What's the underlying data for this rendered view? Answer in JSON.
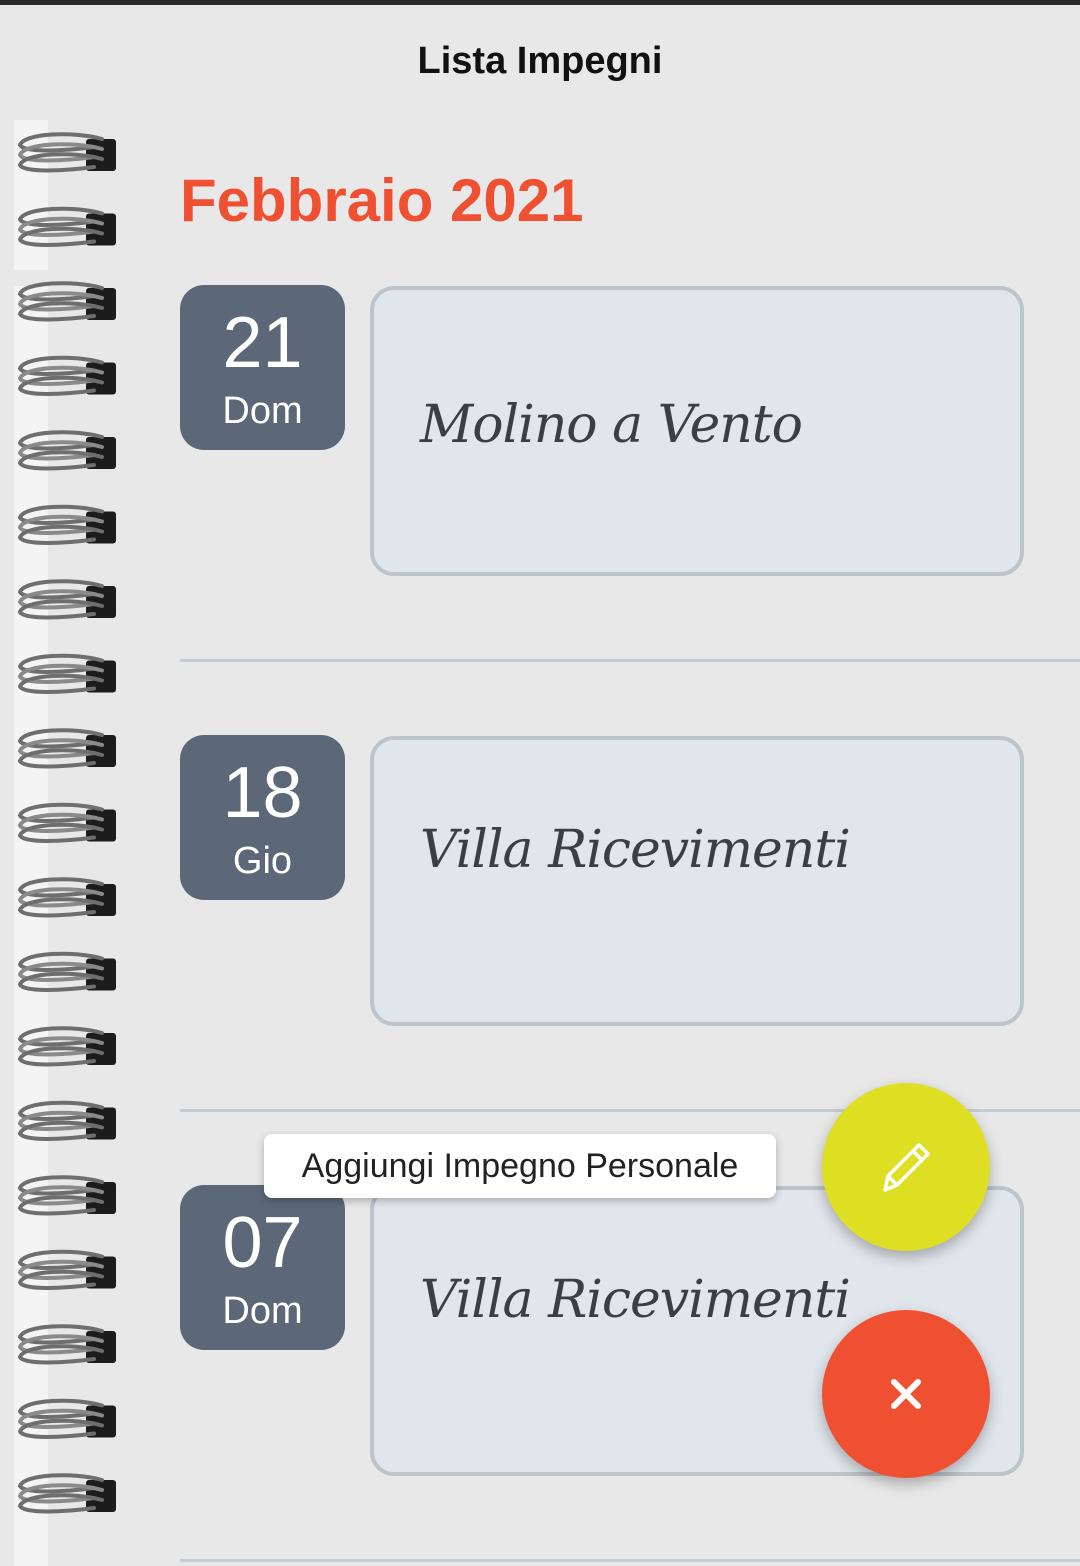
{
  "header": {
    "title": "Lista Impegni"
  },
  "month_heading": "Febbraio 2021",
  "events": [
    {
      "day_number": "21",
      "day_name": "Dom",
      "title": "Molino a Vento"
    },
    {
      "day_number": "18",
      "day_name": "Gio",
      "title": "Villa Ricevimenti"
    },
    {
      "day_number": "07",
      "day_name": "Dom",
      "title": "Villa Ricevimenti"
    }
  ],
  "fab_menu": {
    "tooltip": "Aggiungi Impegno Personale",
    "edit_icon": "pencil-icon",
    "close_icon": "close-icon"
  },
  "colors": {
    "accent_orange": "#f05032",
    "fab_yellow": "#dede22",
    "badge_slate": "#5c6878",
    "card_bg": "#e1e6ec"
  }
}
